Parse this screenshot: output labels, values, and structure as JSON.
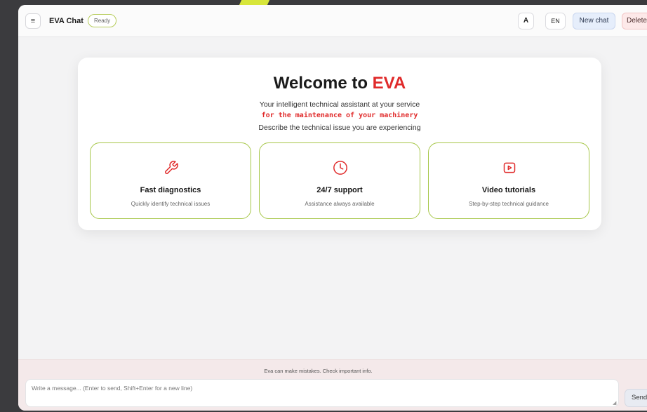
{
  "header": {
    "menu_icon": "menu-icon",
    "title": "EVA Chat",
    "status": "Ready",
    "font_button": "A",
    "language": "EN",
    "new_chat": "New chat",
    "delete": "Delete"
  },
  "welcome": {
    "title_prefix": "Welcome to ",
    "title_brand": "EVA",
    "line1": "Your intelligent technical assistant at your service",
    "line2": "for the maintenance of your machinery",
    "line3": "Describe the technical issue you are experiencing"
  },
  "features": [
    {
      "icon": "wrench-icon",
      "title": "Fast diagnostics",
      "description": "Quickly identify technical issues"
    },
    {
      "icon": "clock-icon",
      "title": "24/7 support",
      "description": "Assistance always available"
    },
    {
      "icon": "video-icon",
      "title": "Video tutorials",
      "description": "Step-by-step technical guidance"
    }
  ],
  "footer": {
    "disclaimer": "Eva can make mistakes. Check important info.",
    "placeholder": "Write a message... (Enter to send, Shift+Enter for a new line)",
    "send": "Send"
  },
  "colors": {
    "brand_red": "#e02a2a",
    "accent_green": "#a7c74a",
    "new_chat_bg": "#e6eefb",
    "delete_bg": "#fde9e9",
    "footer_bg": "#f4e9ea"
  }
}
